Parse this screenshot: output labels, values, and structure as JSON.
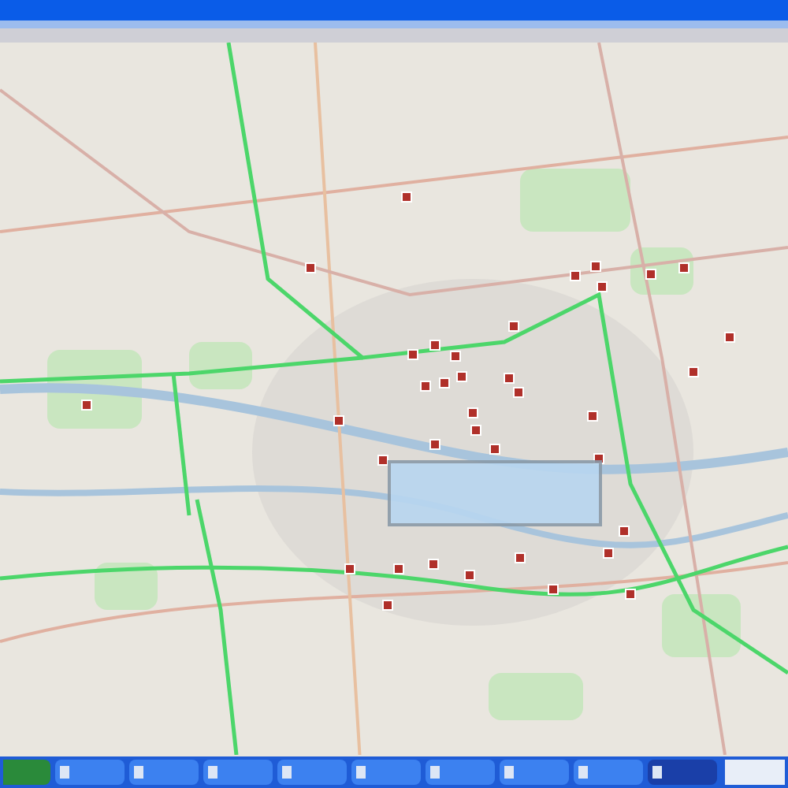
{
  "taskbar": {
    "buttons": [
      {
        "selected": false
      },
      {
        "selected": false
      },
      {
        "selected": false
      },
      {
        "selected": false
      },
      {
        "selected": false
      },
      {
        "selected": false
      },
      {
        "selected": false
      },
      {
        "selected": false
      },
      {
        "selected": true
      }
    ]
  }
}
